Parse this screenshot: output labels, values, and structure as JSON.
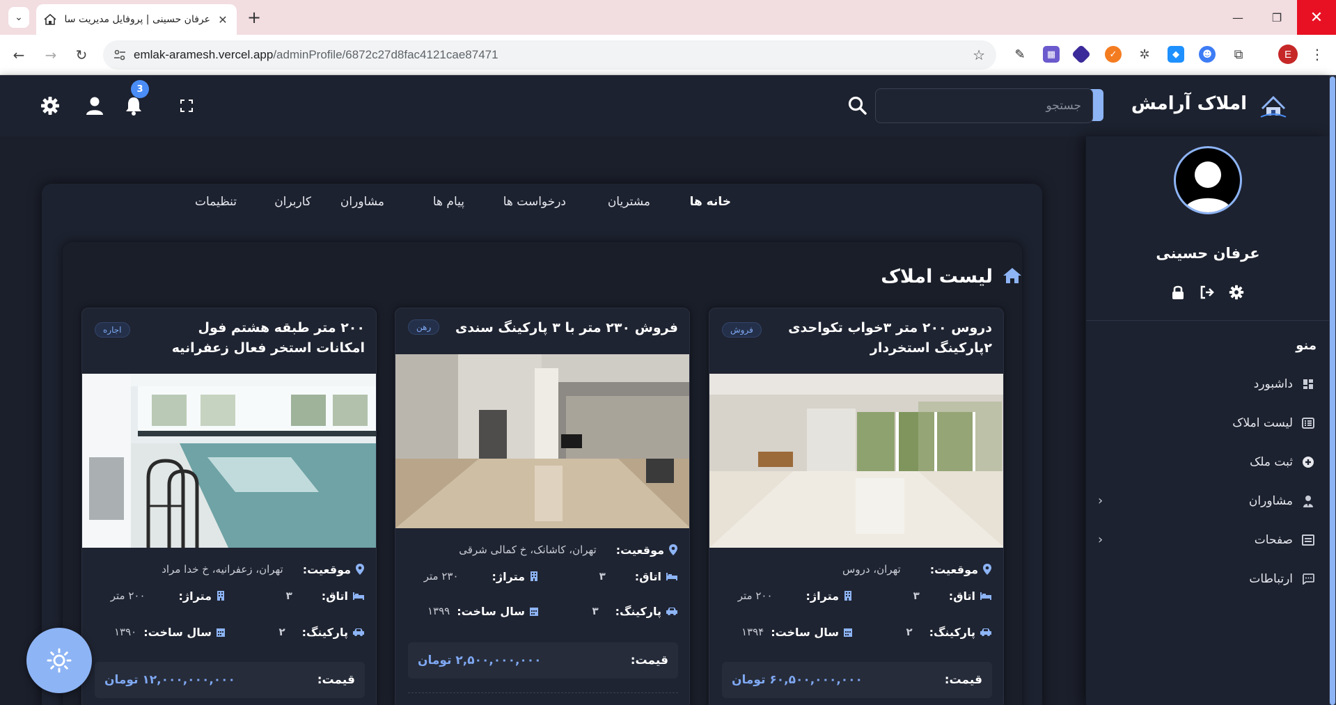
{
  "browser": {
    "tab_title": "عرفان حسینی | پروفایل مدیریت سا",
    "url_host": "emlak-aramesh.vercel.app",
    "url_path": "/adminProfile/6872c27d8fac4121cae87471",
    "profile_initial": "E"
  },
  "header": {
    "brand": "املاک آرامش",
    "search_placeholder": "جستجو",
    "notification_count": "3"
  },
  "sidebar": {
    "user_name": "عرفان حسینی",
    "menu_title": "منو",
    "items": [
      {
        "label": "داشبورد",
        "icon": "dashboard-icon"
      },
      {
        "label": "لیست املاک",
        "icon": "list-icon"
      },
      {
        "label": "ثبت ملک",
        "icon": "plus-circle-icon"
      },
      {
        "label": "مشاوران",
        "icon": "user-tie-icon"
      },
      {
        "label": "صفحات",
        "icon": "pages-icon"
      },
      {
        "label": "ارتباطات",
        "icon": "chat-icon"
      }
    ]
  },
  "main": {
    "nav": [
      "خانه ها",
      "مشتریان",
      "درخواست ها",
      "پیام ها",
      "مشاوران",
      "کاربران",
      "تنظیمات"
    ],
    "list_title": "لیست املاک",
    "cards": [
      {
        "title": "دروس ۲۰۰ متر ۳خواب تکواحدی ۲پارکینگ استخردار",
        "badge": "فروش",
        "location_label": "موقعیت:",
        "location": "تهران، دروس",
        "rooms_label": "اتاق:",
        "rooms": "۳",
        "area_label": "متراژ:",
        "area": "۲۰۰ متر",
        "parking_label": "پارکینگ:",
        "parking": "۲",
        "year_label": "سال ساخت:",
        "year": "۱۳۹۴",
        "price_label": "قیمت:",
        "price": "۶۰,۵۰۰,۰۰۰,۰۰۰ تومان"
      },
      {
        "title": "فروش ۲۳۰ متر با ۳ پارکینگ سندی",
        "badge": "رهن",
        "location_label": "موقعیت:",
        "location": "تهران، کاشانک، خ کمالی شرقی",
        "rooms_label": "اتاق:",
        "rooms": "۳",
        "area_label": "متراژ:",
        "area": "۲۳۰ متر",
        "parking_label": "پارکینگ:",
        "parking": "۳",
        "year_label": "سال ساخت:",
        "year": "۱۳۹۹",
        "price_label": "قیمت:",
        "price": "۲,۵۰۰,۰۰۰,۰۰۰ تومان"
      },
      {
        "title": "۲۰۰ متر طبقه هشتم فول امکانات استخر فعال زعفرانیه",
        "badge": "اجاره",
        "location_label": "موقعیت:",
        "location": "تهران، زعفرانیه، خ خدا مراد",
        "rooms_label": "اتاق:",
        "rooms": "۳",
        "area_label": "متراژ:",
        "area": "۲۰۰ متر",
        "parking_label": "پارکینگ:",
        "parking": "۲",
        "year_label": "سال ساخت:",
        "year": "۱۳۹۰",
        "price_label": "قیمت:",
        "price": "۱۲,۰۰۰,۰۰۰,۰۰۰ تومان"
      }
    ]
  },
  "colors": {
    "accent": "#8db4f5",
    "bg": "#1b1f2b",
    "panel": "#1d2230",
    "price": "#7fa8f2"
  }
}
